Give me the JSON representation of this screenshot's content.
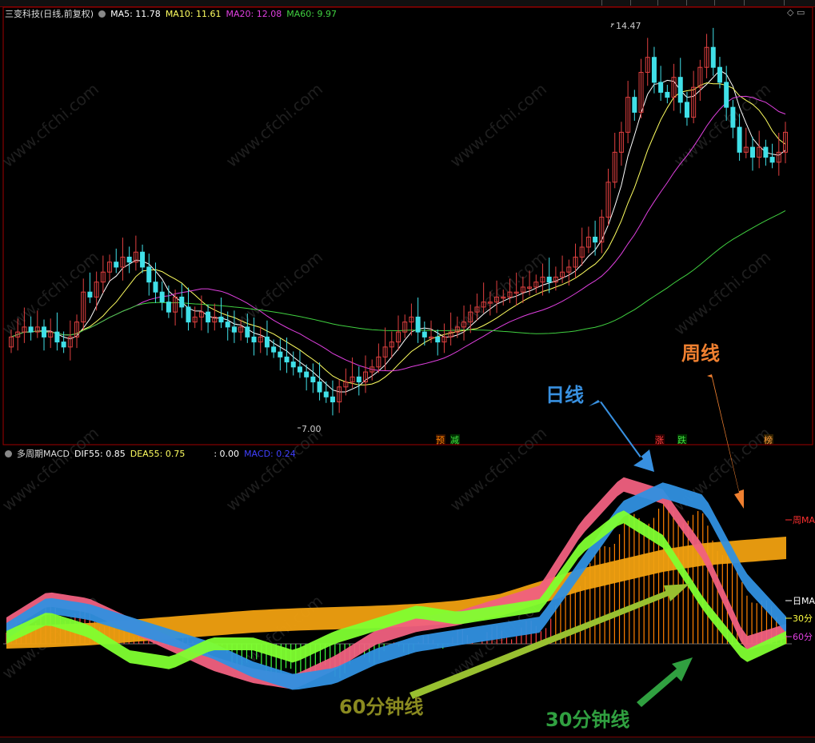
{
  "price_panel": {
    "title": "三变科技(日线,前复权)",
    "ma5": "MA5: 11.78",
    "ma10": "MA10: 11.61",
    "ma20": "MA20: 12.08",
    "ma60": "MA60: 9.97",
    "high_label": "14.47",
    "low_label": "7.00",
    "markers": [
      "预",
      "减",
      "涨",
      "跌",
      "榜"
    ]
  },
  "macd_panel": {
    "title": "多周期MACD",
    "dif": "DIF55: 0.85",
    "dea": "DEA55: 0.75",
    "blank": ": 0.00",
    "macd": "MACD: 0.24",
    "right_labels": [
      "周MA",
      "日MA",
      "30分",
      "60分"
    ]
  },
  "annotations": {
    "weekly": "周线",
    "daily": "日线",
    "min60": "60分钟线",
    "min30": "30分钟线"
  },
  "watermark": "www.cfchi.com",
  "colors": {
    "bg": "#000000",
    "up": "#e04040",
    "down": "#40e0e8",
    "ma5": "#ffffff",
    "ma10": "#ffff60",
    "ma20": "#e040e0",
    "ma60": "#40d040",
    "weekly_band": "#f0a010",
    "daily_band": "#3090e0",
    "min60_band": "#f06080",
    "min30_band": "#80ff30",
    "purple_band": "#8040ff",
    "axis_line": "#a00000"
  },
  "chart_data": [
    {
      "type": "candlestick",
      "title": "三变科技(日线,前复权)",
      "x": [
        0,
        1,
        2,
        3,
        4,
        5,
        6,
        7,
        8,
        9,
        10,
        11,
        12,
        13,
        14,
        15,
        16,
        17,
        18,
        19,
        20,
        21,
        22,
        23,
        24,
        25,
        26,
        27,
        28,
        29,
        30,
        31,
        32,
        33,
        34,
        35,
        36,
        37,
        38,
        39,
        40,
        41,
        42,
        43,
        44,
        45,
        46,
        47,
        48,
        49,
        50,
        51,
        52,
        53,
        54,
        55,
        56,
        57,
        58,
        59,
        60,
        61,
        62,
        63,
        64,
        65,
        66,
        67,
        68,
        69,
        70,
        71,
        72,
        73,
        74,
        75,
        76,
        77,
        78,
        79,
        80,
        81,
        82,
        83,
        84,
        85,
        86,
        87,
        88,
        89,
        90,
        91,
        92,
        93,
        94,
        95,
        96,
        97,
        98,
        99,
        100,
        101,
        102,
        103,
        104,
        105,
        106,
        107,
        108,
        109,
        110,
        111,
        112,
        113,
        114,
        115,
        116,
        117,
        118,
        119,
        120,
        121,
        122,
        123,
        124,
        125,
        126,
        127,
        128,
        129,
        130,
        131,
        132,
        133,
        134,
        135,
        136,
        137,
        138,
        139,
        140,
        141
      ],
      "open": [
        8.3,
        8.5,
        8.6,
        8.7,
        8.6,
        8.7,
        8.5,
        8.6,
        8.4,
        8.3,
        8.5,
        8.8,
        9.4,
        9.3,
        9.6,
        9.8,
        10.0,
        9.9,
        10.1,
        10.0,
        10.2,
        9.9,
        9.6,
        9.4,
        9.2,
        9.0,
        9.3,
        9.1,
        8.8,
        8.9,
        9.0,
        8.8,
        8.9,
        8.8,
        8.7,
        8.6,
        8.7,
        8.5,
        8.4,
        8.5,
        8.3,
        8.2,
        8.1,
        8.0,
        7.9,
        7.8,
        7.7,
        7.6,
        7.4,
        7.3,
        7.2,
        7.5,
        7.6,
        7.7,
        7.6,
        7.8,
        7.9,
        8.1,
        8.3,
        8.4,
        8.6,
        8.8,
        8.9,
        8.6,
        8.5,
        8.5,
        8.4,
        8.5,
        8.6,
        8.7,
        8.8,
        9.0,
        9.1,
        9.2,
        9.2,
        9.3,
        9.3,
        9.4,
        9.4,
        9.5,
        9.5,
        9.6,
        9.7,
        9.6,
        9.7,
        9.8,
        9.9,
        10.1,
        10.3,
        10.5,
        10.4,
        10.9,
        11.6,
        12.2,
        12.6,
        13.3,
        13.0,
        13.8,
        14.1,
        13.6,
        13.4,
        13.3,
        13.7,
        13.2,
        12.9,
        13.5,
        13.9,
        14.3,
        13.9,
        13.6,
        13.1,
        12.7,
        12.2,
        12.3,
        12.1,
        12.3,
        12.1,
        12.0,
        12.2
      ],
      "close": [
        8.5,
        8.6,
        8.7,
        8.6,
        8.7,
        8.5,
        8.6,
        8.4,
        8.3,
        8.5,
        8.8,
        9.4,
        9.3,
        9.6,
        9.8,
        10.0,
        9.9,
        10.1,
        10.0,
        10.2,
        9.9,
        9.6,
        9.4,
        9.2,
        9.0,
        9.3,
        9.1,
        8.8,
        8.9,
        9.0,
        8.8,
        8.9,
        8.8,
        8.7,
        8.6,
        8.7,
        8.5,
        8.4,
        8.5,
        8.3,
        8.2,
        8.1,
        8.0,
        7.9,
        7.8,
        7.7,
        7.6,
        7.4,
        7.3,
        7.2,
        7.5,
        7.6,
        7.7,
        7.6,
        7.8,
        7.9,
        8.1,
        8.3,
        8.4,
        8.6,
        8.8,
        8.9,
        8.6,
        8.5,
        8.5,
        8.4,
        8.5,
        8.6,
        8.7,
        8.8,
        9.0,
        9.1,
        9.2,
        9.2,
        9.3,
        9.3,
        9.4,
        9.4,
        9.5,
        9.5,
        9.6,
        9.7,
        9.6,
        9.7,
        9.8,
        9.9,
        10.1,
        10.3,
        10.5,
        10.4,
        10.9,
        11.6,
        12.2,
        12.6,
        13.3,
        13.0,
        13.8,
        14.1,
        13.6,
        13.4,
        13.3,
        13.7,
        13.2,
        12.9,
        13.5,
        13.9,
        14.3,
        13.9,
        13.6,
        13.1,
        12.7,
        12.2,
        12.3,
        12.1,
        12.3,
        12.1,
        12.0,
        12.2,
        12.6
      ]
    },
    {
      "type": "area",
      "title": "多周期MACD",
      "series": [
        {
          "name": "周MA",
          "values": [
            0.1,
            0.12,
            0.15,
            0.2,
            0.25,
            0.3,
            0.35,
            0.38,
            0.4,
            0.42,
            0.45,
            0.5,
            0.6,
            0.8,
            1.0,
            1.15,
            1.3,
            1.4,
            1.45,
            1.5
          ]
        },
        {
          "name": "日MA",
          "values": [
            0.2,
            0.6,
            0.5,
            0.3,
            0.1,
            -0.1,
            -0.4,
            -0.6,
            -0.5,
            -0.2,
            0.0,
            0.1,
            0.2,
            0.3,
            1.2,
            2.1,
            2.4,
            2.2,
            1.0,
            0.3
          ]
        },
        {
          "name": "30分",
          "values": [
            0.1,
            0.4,
            0.2,
            -0.2,
            -0.3,
            0.0,
            0.0,
            -0.2,
            0.1,
            0.3,
            0.5,
            0.4,
            0.5,
            0.6,
            1.5,
            2.0,
            1.6,
            0.6,
            -0.2,
            0.1
          ]
        },
        {
          "name": "60分",
          "values": [
            0.3,
            0.7,
            0.6,
            0.3,
            0.0,
            -0.3,
            -0.5,
            -0.6,
            -0.3,
            0.1,
            0.3,
            0.4,
            0.6,
            0.8,
            1.8,
            2.5,
            2.3,
            1.4,
            0.0,
            0.2
          ]
        }
      ]
    }
  ]
}
